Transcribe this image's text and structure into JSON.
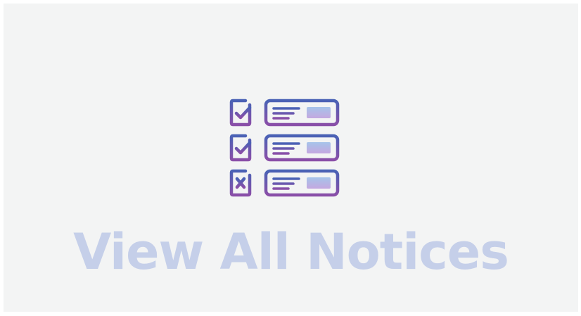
{
  "notices_button": {
    "label": "View All Notices",
    "icon": "checklist-icon",
    "label_color": "#c5cfe9",
    "background_color": "#f3f4f4"
  },
  "checklist_icon": {
    "rows": [
      {
        "status": "checked"
      },
      {
        "status": "checked"
      },
      {
        "status": "crossed"
      }
    ],
    "gradient_top_color": "#4a62b5",
    "gradient_bottom_color": "#8a4fa8",
    "bar_fill_top_color": "#a6c4ea",
    "bar_fill_bottom_color": "#c4a8e0"
  }
}
